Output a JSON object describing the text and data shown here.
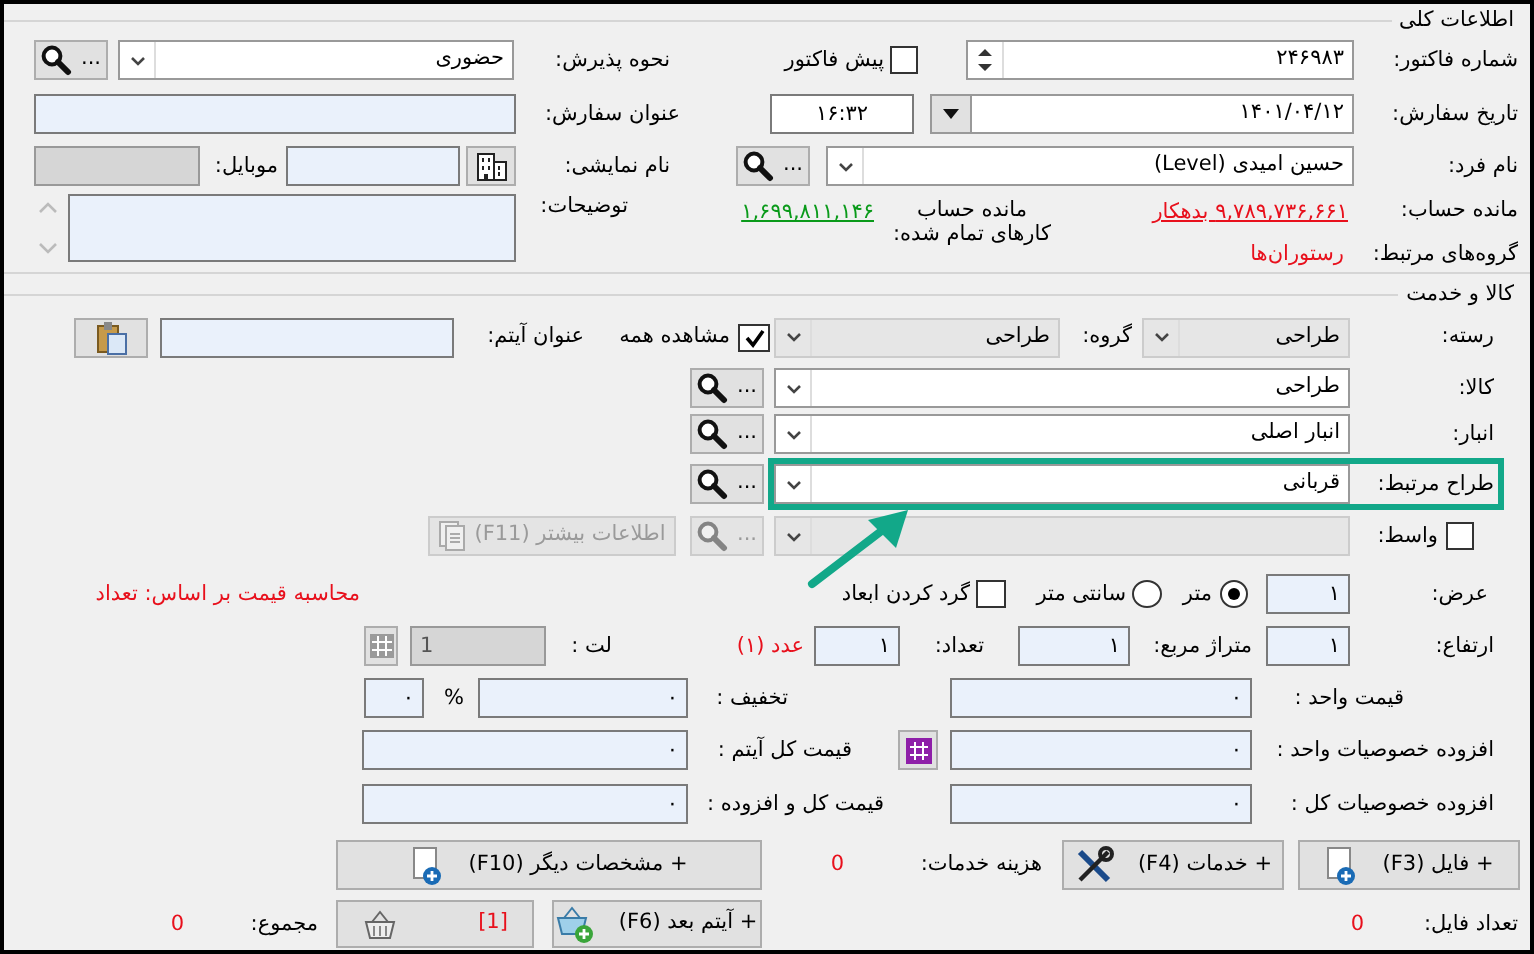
{
  "general": {
    "title": "اطلاعات کلی",
    "invoice_number": {
      "label": "شماره فاکتور:",
      "value": "۲۴۶۹۸۳"
    },
    "pre_invoice": {
      "label": "پیش فاکتور",
      "checked": false
    },
    "reception": {
      "label": "نحوه پذیرش:",
      "value": "حضوری",
      "button": "..."
    },
    "order_date": {
      "label": "تاریخ سفارش:",
      "value": "۱۴۰۱/۰۴/۱۲",
      "time": "۱۶:۳۲"
    },
    "order_title": {
      "label": "عنوان سفارش:"
    },
    "person": {
      "label": "نام فرد:",
      "value": "حسین امیدی (Level)",
      "button": "..."
    },
    "display_name": {
      "label": "نام نمایشی:"
    },
    "mobile": {
      "label": "موبایل:"
    },
    "balance": {
      "label": "مانده حساب:",
      "value": "۹,۷۸۹,۷۳۶,۶۶۱ بدهکار"
    },
    "completed_balance": {
      "label": "مانده حساب\nکارهای تمام شده:",
      "value": "۱,۶۹۹,۸۱۱,۱۴۶"
    },
    "notes": {
      "label": "توضیحات:"
    },
    "groups": {
      "label": "گروه‌های مرتبط:",
      "value": "رستوران‌ها"
    }
  },
  "goods": {
    "title": "کالا و خدمت",
    "category": {
      "label": "رسته:",
      "value": "طراحی",
      "disabled": true
    },
    "group": {
      "label": "گروه:",
      "value": "طراحی",
      "disabled": true
    },
    "show_all": {
      "label": "مشاهده همه",
      "checked": true
    },
    "item_title": {
      "label": "عنوان آیتم:"
    },
    "lookups": [
      {
        "label": "کالا:",
        "value": "طراحی",
        "button": "...",
        "highlighted": false
      },
      {
        "label": "انبار:",
        "value": "انبار اصلی",
        "button": "...",
        "highlighted": false
      },
      {
        "label": "طراح مرتبط:",
        "value": "قربانی",
        "button": "...",
        "highlighted": true
      }
    ],
    "mediator": {
      "label": "واسط:",
      "checked": false,
      "disabled": true,
      "button": "..."
    },
    "more_info": {
      "label": "اطلاعات بیشتر (F11)",
      "disabled": true
    },
    "width": {
      "label": "عرض:",
      "value": "۱"
    },
    "units": [
      {
        "label": "متر",
        "selected": true
      },
      {
        "label": "سانتی متر",
        "selected": false
      }
    ],
    "round": {
      "label": "گرد کردن ابعاد",
      "checked": false
    },
    "price_basis": "محاسبه قیمت بر اساس: تعداد",
    "height": {
      "label": "ارتفاع:",
      "value": "۱"
    },
    "area": {
      "label": "متراژ مربع:",
      "value": "۱"
    },
    "count": {
      "label": "تعداد:",
      "value": "۱",
      "unit": "عدد (۱)"
    },
    "leaf": {
      "label": "لت :",
      "value": "1"
    },
    "unit_price": {
      "label": "قیمت واحد :",
      "value": "۰"
    },
    "discount": {
      "label": "تخفیف :",
      "value": "۰",
      "percent_sign": "%",
      "percent": "۰"
    },
    "unit_extras": {
      "label": "افزوده خصوصیات واحد :",
      "value": "۰"
    },
    "item_total": {
      "label": "قیمت کل آیتم :",
      "value": "۰"
    },
    "total_extras": {
      "label": "افزوده خصوصیات کل :",
      "value": "۰"
    },
    "total_with_extras": {
      "label": "قیمت کل و افزوده :",
      "value": "۰"
    }
  },
  "actions": {
    "file_button": "+ فایل (F3)",
    "services_button": "+ خدمات (F4)",
    "service_cost": {
      "label": "هزینه خدمات:",
      "value": "0"
    },
    "other_specs_button": "+ مشخصات دیگر (F10)",
    "file_count": {
      "label": "تعداد فایل:",
      "value": "0"
    },
    "next_item_button": "+ آیتم بعد (F6)",
    "cart_button": "[1]",
    "total": {
      "label": "مجموع:",
      "value": "0"
    }
  }
}
